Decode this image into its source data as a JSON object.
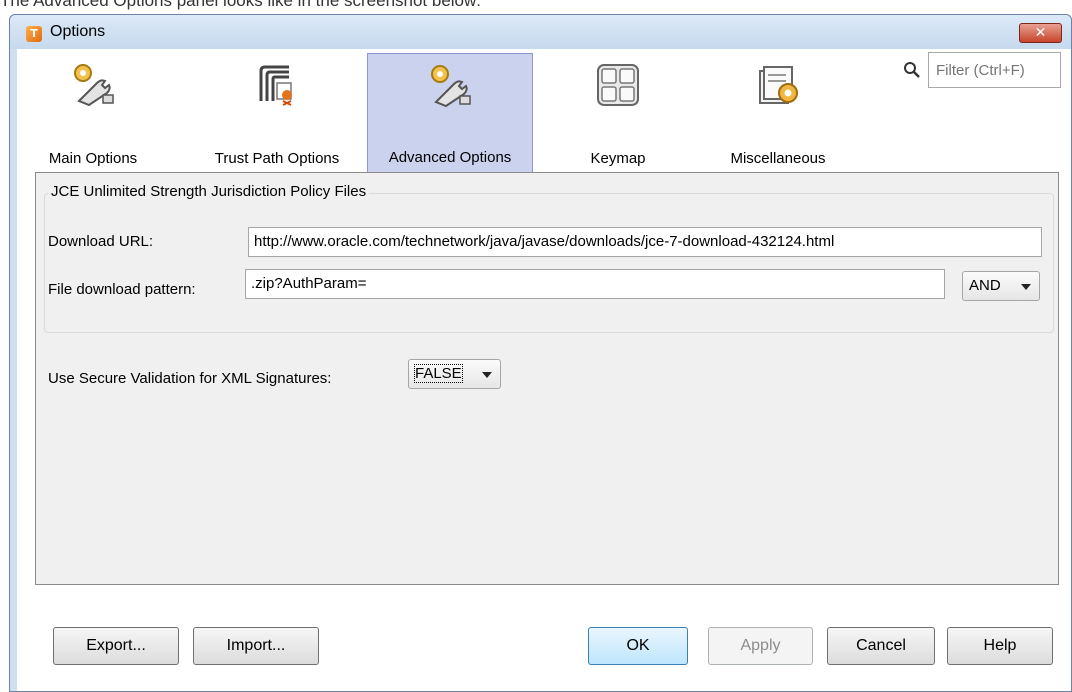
{
  "caption": "The Advanced Options panel looks like in the screenshot below:",
  "window": {
    "title": "Options",
    "close_label": "✕"
  },
  "toolbar": {
    "categories": [
      {
        "label": "Main Options",
        "icon": "gears-wrench-icon"
      },
      {
        "label": "Trust Path Options",
        "icon": "trust-path-icon"
      },
      {
        "label": "Advanced Options",
        "icon": "gears-wrench-icon",
        "selected": true
      },
      {
        "label": "Keymap",
        "icon": "keyboard-keys-icon"
      },
      {
        "label": "Miscellaneous",
        "icon": "folders-gear-icon"
      }
    ],
    "filter_placeholder": "Filter (Ctrl+F)"
  },
  "panel": {
    "group_title": "JCE Unlimited Strength Jurisdiction Policy Files",
    "download_url_label": "Download URL:",
    "download_url_value": "http://www.oracle.com/technetwork/java/javase/downloads/jce-7-download-432124.html",
    "pattern_label": "File download pattern:",
    "pattern_value": ".zip?AuthParam=",
    "pattern_operator": "AND",
    "secure_validation_label": "Use Secure Validation for XML Signatures:",
    "secure_validation_value": "FALSE"
  },
  "buttons": {
    "export": "Export...",
    "import": "Import...",
    "ok": "OK",
    "apply": "Apply",
    "cancel": "Cancel",
    "help": "Help"
  },
  "colors": {
    "selected_tab_bg": "#cbd2ee",
    "window_frame": "#cfdff0",
    "close_button": "#c7442b"
  }
}
